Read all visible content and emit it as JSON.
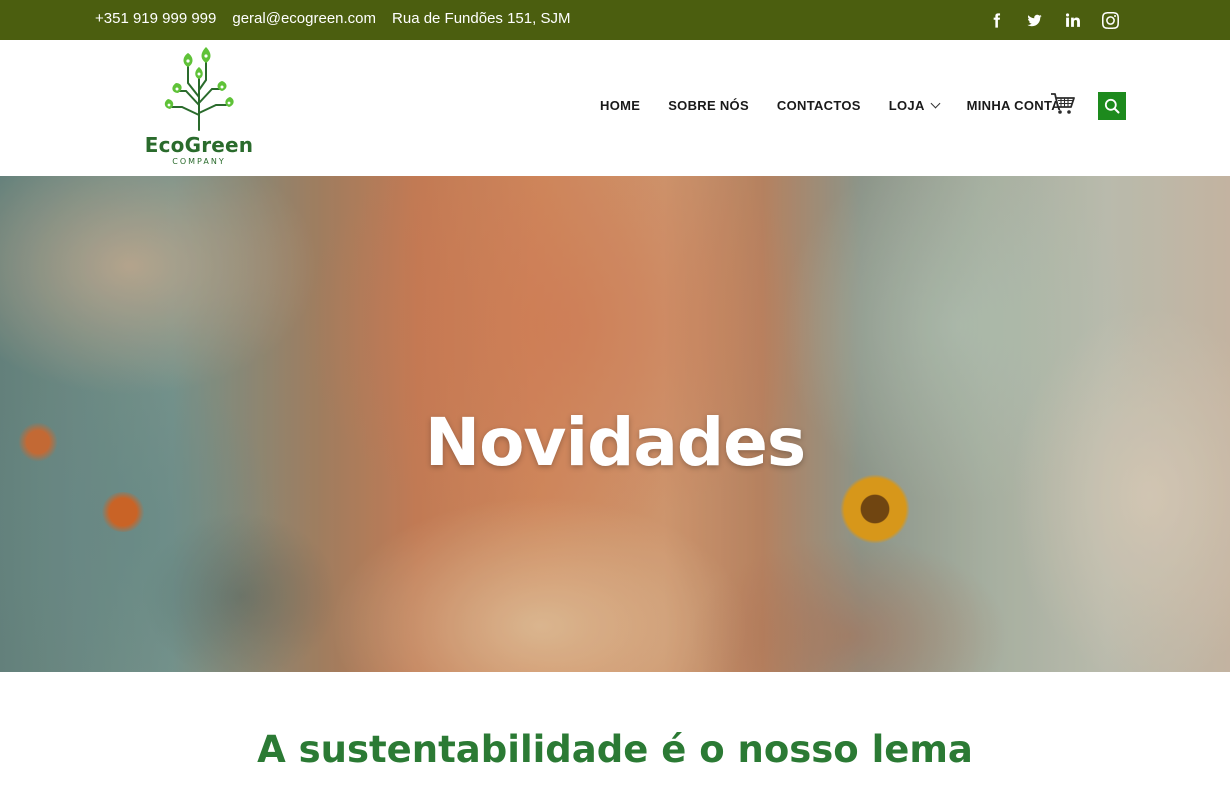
{
  "topbar": {
    "phone": "+351 919 999 999",
    "email": "geral@ecogreen.com",
    "address": "Rua de Fundões 151, SJM",
    "social": [
      {
        "name": "facebook-icon"
      },
      {
        "name": "twitter-icon"
      },
      {
        "name": "linkedin-icon"
      },
      {
        "name": "instagram-icon"
      }
    ],
    "bg_color": "#4b5e0f"
  },
  "logo": {
    "word": "EcoGreen",
    "sub": "COMPANY",
    "color": "#2a6b2c"
  },
  "nav": {
    "items": [
      {
        "label": "HOME"
      },
      {
        "label": "SOBRE NÓS"
      },
      {
        "label": "CONTACTOS"
      },
      {
        "label": "LOJA",
        "has_dropdown": true
      },
      {
        "label": "MINHA CONTA"
      }
    ],
    "cart_icon": "cart-icon",
    "search_icon": "search-icon",
    "search_bg": "#1d8a1d"
  },
  "hero": {
    "title": "Novidades"
  },
  "section": {
    "heading": "A sustentabilidade é o nosso lema",
    "heading_color": "#2b7a34"
  }
}
